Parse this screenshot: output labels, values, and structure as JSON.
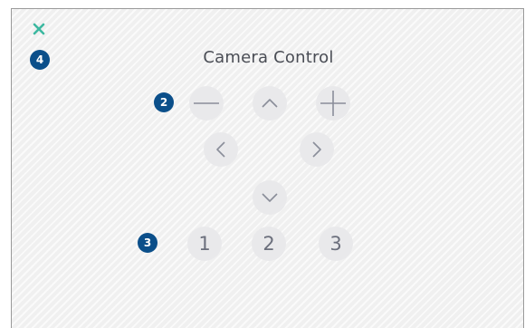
{
  "panel": {
    "title": "Camera Control",
    "accent_color": "#3cb8a0",
    "badge_color": "#0b4f8a"
  },
  "badges": {
    "close": "4",
    "zoom_row": "2",
    "presets_row": "3"
  },
  "controls": {
    "zoom_out_icon": "minus-icon",
    "zoom_in_icon": "plus-icon",
    "tilt_up_icon": "chevron-up-icon",
    "tilt_down_icon": "chevron-down-icon",
    "pan_left_icon": "chevron-left-icon",
    "pan_right_icon": "chevron-right-icon"
  },
  "presets": [
    "1",
    "2",
    "3"
  ]
}
